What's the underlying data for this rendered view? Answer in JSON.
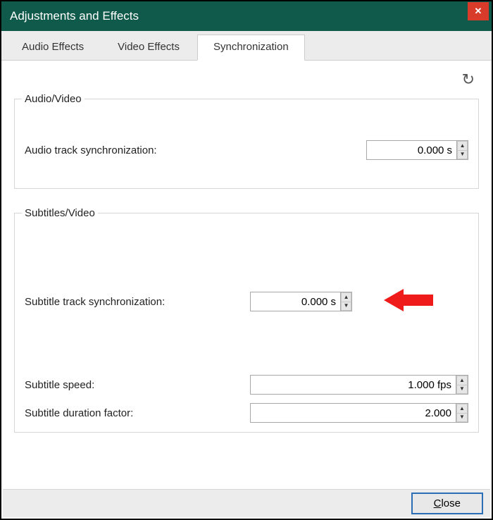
{
  "window": {
    "title": "Adjustments and Effects"
  },
  "tabs": {
    "audio_effects": "Audio Effects",
    "video_effects": "Video Effects",
    "synchronization": "Synchronization"
  },
  "groups": {
    "audio_video": {
      "legend": "Audio/Video",
      "audio_sync_label": "Audio track synchronization:",
      "audio_sync_value": "0.000 s"
    },
    "subtitles_video": {
      "legend": "Subtitles/Video",
      "sub_sync_label": "Subtitle track synchronization:",
      "sub_sync_value": "0.000 s",
      "sub_speed_label": "Subtitle speed:",
      "sub_speed_value": "1.000 fps",
      "sub_dur_label": "Subtitle duration factor:",
      "sub_dur_value": "2.000"
    }
  },
  "footer": {
    "close_label": "Close"
  }
}
